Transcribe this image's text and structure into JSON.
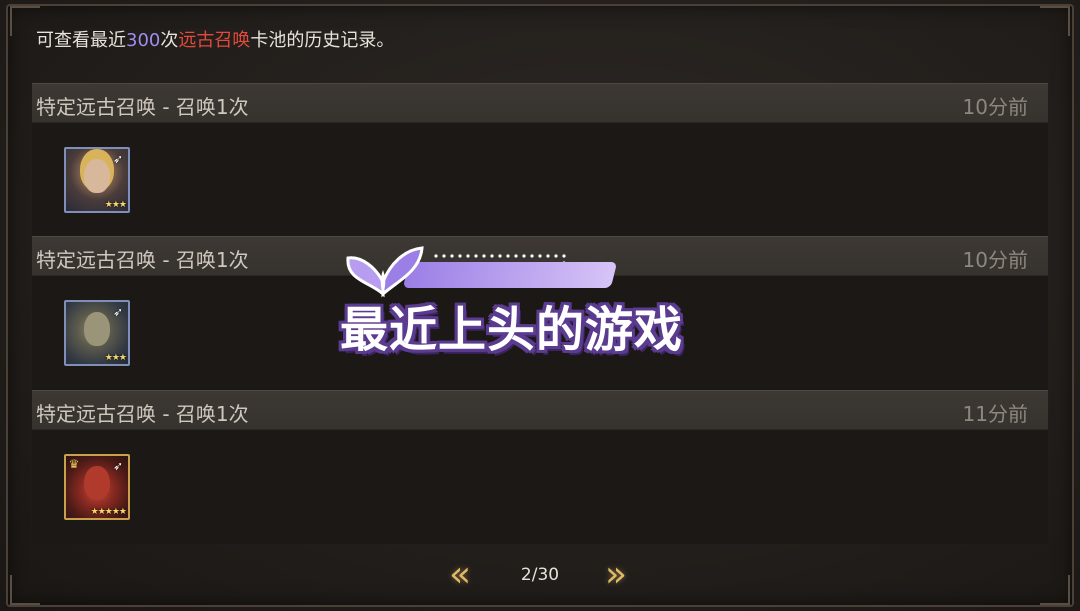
{
  "header": {
    "intro_prefix": "可查看最近",
    "intro_count": "300",
    "intro_mid": "次",
    "intro_pool": "远古召唤",
    "intro_suffix": "卡池的历史记录。"
  },
  "records": [
    {
      "title": "特定远古召唤 - 召唤1次",
      "time": "10分前",
      "hero": {
        "stars": "★★★",
        "rarity": "blue",
        "icon": "bow-icon"
      }
    },
    {
      "title": "特定远古召唤 - 召唤1次",
      "time": "10分前",
      "hero": {
        "stars": "★★★",
        "rarity": "blue",
        "icon": "bow-icon"
      }
    },
    {
      "title": "特定远古召唤 - 召唤1次",
      "time": "11分前",
      "hero": {
        "stars": "★★★★★",
        "rarity": "gold",
        "icon": "bow-icon"
      }
    }
  ],
  "pager": {
    "prev_label": "«",
    "next_label": "»",
    "page": "2/30"
  },
  "overlay": {
    "caption": "最近上头的游戏"
  },
  "colors": {
    "count_accent": "#9d8ef0",
    "pool_accent": "#e34a3c",
    "nav_gold": "#e0b968"
  }
}
